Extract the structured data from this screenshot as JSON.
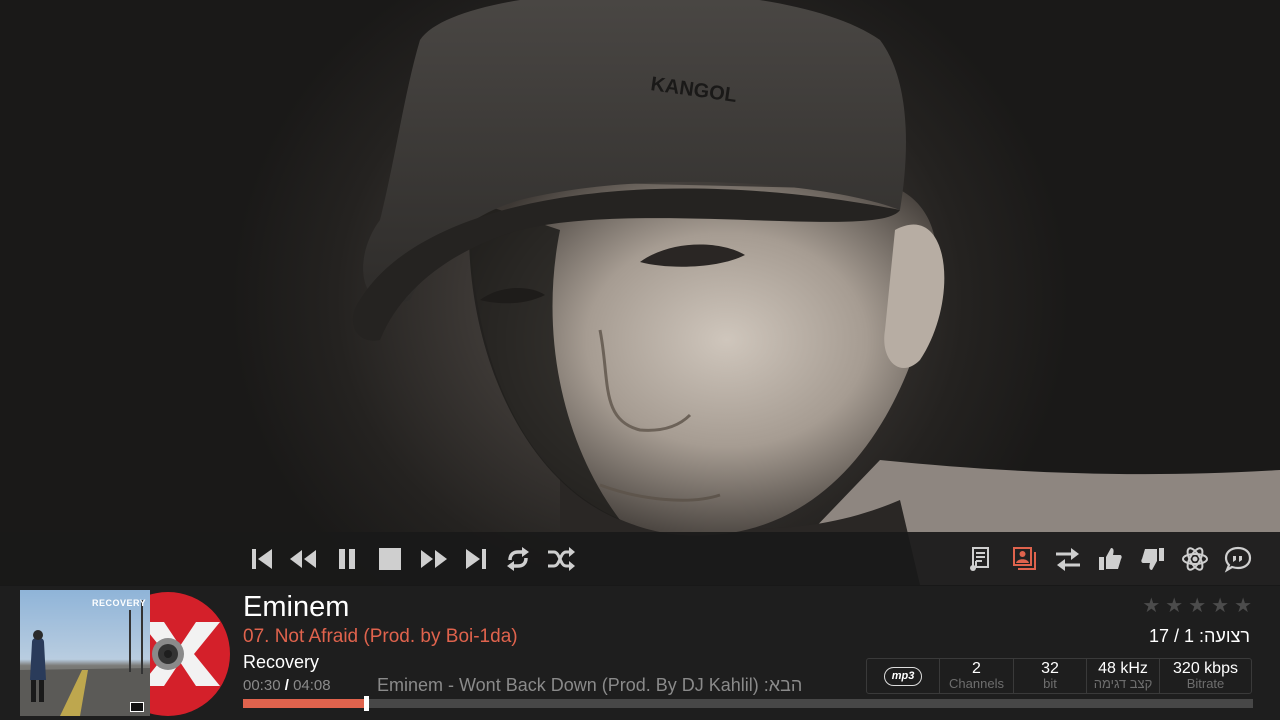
{
  "now_playing": {
    "artist": "Eminem",
    "track": "07. Not Afraid (Prod. by Boi-1da)",
    "album": "Recovery",
    "elapsed": "00:30",
    "time_separator": "/",
    "duration": "04:08",
    "next_up": "הבא: Eminem - Wont Back Down (Prod. By DJ Kahlil)",
    "progress_fraction": 0.12
  },
  "album_art": {
    "title": "RECOVERY"
  },
  "rating": {
    "stars": 0,
    "max_stars": 5
  },
  "playlist": {
    "position_text": "רצועה: 1 / 17"
  },
  "codec_info": {
    "format_badge": "mp3",
    "channels_value": "2",
    "channels_label": "Channels",
    "bitdepth_value": "32",
    "bitdepth_label": "bit",
    "samplerate_value": "48 kHz",
    "samplerate_label": "קצב דגימה",
    "bitrate_value": "320 kbps",
    "bitrate_label": "Bitrate"
  },
  "transport": {
    "left_controls": [
      "skip-previous-icon",
      "rewind-icon",
      "pause-icon",
      "stop-icon",
      "fast-forward-icon",
      "skip-next-icon",
      "repeat-icon",
      "shuffle-icon"
    ],
    "right_controls": [
      "lyrics-icon",
      "artist-slideshow-icon",
      "playlist-icon",
      "thumbs-up-icon",
      "thumbs-down-icon",
      "visualization-icon",
      "subtitles-icon"
    ],
    "accent_color": "#e0634d",
    "icon_color": "#d0d0d0"
  }
}
